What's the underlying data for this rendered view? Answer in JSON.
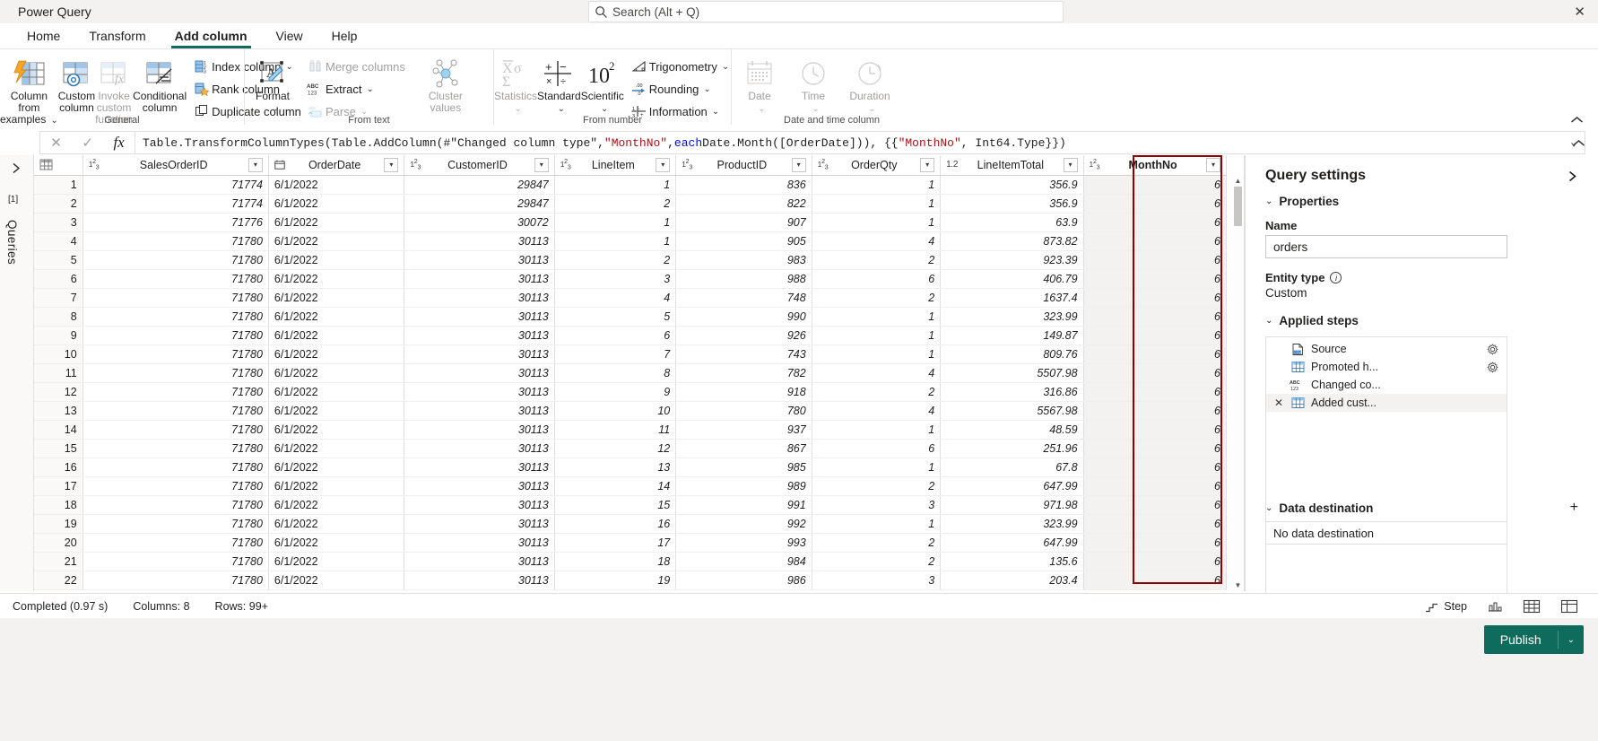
{
  "window": {
    "app_title": "Power Query",
    "close_label": "✕"
  },
  "search": {
    "placeholder": "Search (Alt + Q)",
    "icon": "search-icon"
  },
  "ribbon": {
    "tabs": [
      {
        "label": "Home",
        "active": false
      },
      {
        "label": "Transform",
        "active": false
      },
      {
        "label": "Add column",
        "active": true
      },
      {
        "label": "View",
        "active": false
      },
      {
        "label": "Help",
        "active": false
      }
    ],
    "collapse_icon": "chevron-up-icon",
    "groups": [
      {
        "label": "General",
        "big_buttons": [
          {
            "label": "Column from examples",
            "has_chevron": true,
            "disabled": false,
            "icon": "column-from-examples-icon"
          },
          {
            "label": "Custom column",
            "has_chevron": false,
            "disabled": false,
            "icon": "custom-column-icon"
          },
          {
            "label": "Invoke custom function",
            "has_chevron": false,
            "disabled": true,
            "icon": "invoke-custom-function-icon"
          },
          {
            "label": "Conditional column",
            "has_chevron": false,
            "disabled": false,
            "icon": "conditional-column-icon"
          }
        ],
        "small_buttons": [
          {
            "label": "Index column",
            "has_chevron": true,
            "disabled": false,
            "icon": "index-column-icon"
          },
          {
            "label": "Rank column",
            "has_chevron": false,
            "disabled": false,
            "icon": "rank-column-icon"
          },
          {
            "label": "Duplicate column",
            "has_chevron": false,
            "disabled": false,
            "icon": "duplicate-column-icon"
          }
        ]
      },
      {
        "label": "From text",
        "big_buttons": [
          {
            "label": "Format",
            "has_chevron": true,
            "disabled": false,
            "icon": "format-icon"
          }
        ],
        "small_buttons": [
          {
            "label": "Merge columns",
            "has_chevron": false,
            "disabled": true,
            "icon": "merge-columns-icon"
          },
          {
            "label": "Extract",
            "has_chevron": true,
            "disabled": false,
            "icon": "extract-abc123-icon"
          },
          {
            "label": "Parse",
            "has_chevron": true,
            "disabled": true,
            "icon": "parse-icon"
          }
        ],
        "extra_big": [
          {
            "label": "Cluster values",
            "has_chevron": false,
            "disabled": true,
            "icon": "cluster-values-icon"
          }
        ]
      },
      {
        "label": "From number",
        "big_buttons": [
          {
            "label": "Statistics",
            "has_chevron": true,
            "disabled": true,
            "icon": "statistics-sigma-icon"
          },
          {
            "label": "Standard",
            "has_chevron": true,
            "disabled": false,
            "icon": "standard-operators-icon"
          },
          {
            "label": "Scientific",
            "has_chevron": true,
            "disabled": false,
            "icon": "scientific-power-icon"
          }
        ],
        "small_buttons": [
          {
            "label": "Trigonometry",
            "has_chevron": true,
            "disabled": false,
            "icon": "trigonometry-icon"
          },
          {
            "label": "Rounding",
            "has_chevron": true,
            "disabled": false,
            "icon": "rounding-icon"
          },
          {
            "label": "Information",
            "has_chevron": true,
            "disabled": false,
            "icon": "information-fraction-icon"
          }
        ]
      },
      {
        "label": "Date and time column",
        "big_buttons": [
          {
            "label": "Date",
            "has_chevron": true,
            "disabled": true,
            "icon": "calendar-icon"
          },
          {
            "label": "Time",
            "has_chevron": true,
            "disabled": true,
            "icon": "clock-icon"
          },
          {
            "label": "Duration",
            "has_chevron": true,
            "disabled": true,
            "icon": "duration-icon"
          }
        ],
        "small_buttons": []
      }
    ]
  },
  "formula_bar": {
    "cancel_icon": "close-icon",
    "accept_icon": "checkmark-icon",
    "fx_icon": "fx-icon",
    "expand_icon": "chevron-down-icon",
    "tokens": [
      {
        "t": "Table.TransformColumnTypes(Table.AddColumn(#\"Changed column type\", ",
        "k": "p"
      },
      {
        "t": "\"MonthNo\"",
        "k": "s"
      },
      {
        "t": ", ",
        "k": "p"
      },
      {
        "t": "each",
        "k": "w"
      },
      {
        "t": " Date.Month([OrderDate])), {{",
        "k": "p"
      },
      {
        "t": "\"MonthNo\"",
        "k": "s"
      },
      {
        "t": ", Int64.Type}})",
        "k": "p"
      }
    ],
    "full_text": "Table.TransformColumnTypes(Table.AddColumn(#\"Changed column type\", \"MonthNo\", each Date.Month([OrderDate])), {{\"MonthNo\", Int64.Type}})"
  },
  "queries_rail": {
    "expand_icon": "chevron-right-icon",
    "label": "Queries",
    "count": "[1]"
  },
  "table_data": {
    "type": "table",
    "corner_icon": "select-all-table-icon",
    "columns": [
      {
        "name": "SalesOrderID",
        "type_icon": "123",
        "align": "num",
        "selected": false
      },
      {
        "name": "OrderDate",
        "type_icon": "cal",
        "align": "plain",
        "selected": false
      },
      {
        "name": "CustomerID",
        "type_icon": "123",
        "align": "num",
        "selected": false
      },
      {
        "name": "LineItem",
        "type_icon": "123",
        "align": "num",
        "selected": false
      },
      {
        "name": "ProductID",
        "type_icon": "123",
        "align": "num",
        "selected": false
      },
      {
        "name": "OrderQty",
        "type_icon": "123",
        "align": "num",
        "selected": false
      },
      {
        "name": "LineItemTotal",
        "type_icon": "1.2",
        "align": "num",
        "selected": false
      },
      {
        "name": "MonthNo",
        "type_icon": "123",
        "align": "num",
        "selected": true
      }
    ],
    "rows": [
      {
        "n": "1",
        "v": [
          "71774",
          "6/1/2022",
          "29847",
          "1",
          "836",
          "1",
          "356.9",
          "6"
        ]
      },
      {
        "n": "2",
        "v": [
          "71774",
          "6/1/2022",
          "29847",
          "2",
          "822",
          "1",
          "356.9",
          "6"
        ]
      },
      {
        "n": "3",
        "v": [
          "71776",
          "6/1/2022",
          "30072",
          "1",
          "907",
          "1",
          "63.9",
          "6"
        ]
      },
      {
        "n": "4",
        "v": [
          "71780",
          "6/1/2022",
          "30113",
          "1",
          "905",
          "4",
          "873.82",
          "6"
        ]
      },
      {
        "n": "5",
        "v": [
          "71780",
          "6/1/2022",
          "30113",
          "2",
          "983",
          "2",
          "923.39",
          "6"
        ]
      },
      {
        "n": "6",
        "v": [
          "71780",
          "6/1/2022",
          "30113",
          "3",
          "988",
          "6",
          "406.79",
          "6"
        ]
      },
      {
        "n": "7",
        "v": [
          "71780",
          "6/1/2022",
          "30113",
          "4",
          "748",
          "2",
          "1637.4",
          "6"
        ]
      },
      {
        "n": "8",
        "v": [
          "71780",
          "6/1/2022",
          "30113",
          "5",
          "990",
          "1",
          "323.99",
          "6"
        ]
      },
      {
        "n": "9",
        "v": [
          "71780",
          "6/1/2022",
          "30113",
          "6",
          "926",
          "1",
          "149.87",
          "6"
        ]
      },
      {
        "n": "10",
        "v": [
          "71780",
          "6/1/2022",
          "30113",
          "7",
          "743",
          "1",
          "809.76",
          "6"
        ]
      },
      {
        "n": "11",
        "v": [
          "71780",
          "6/1/2022",
          "30113",
          "8",
          "782",
          "4",
          "5507.98",
          "6"
        ]
      },
      {
        "n": "12",
        "v": [
          "71780",
          "6/1/2022",
          "30113",
          "9",
          "918",
          "2",
          "316.86",
          "6"
        ]
      },
      {
        "n": "13",
        "v": [
          "71780",
          "6/1/2022",
          "30113",
          "10",
          "780",
          "4",
          "5567.98",
          "6"
        ]
      },
      {
        "n": "14",
        "v": [
          "71780",
          "6/1/2022",
          "30113",
          "11",
          "937",
          "1",
          "48.59",
          "6"
        ]
      },
      {
        "n": "15",
        "v": [
          "71780",
          "6/1/2022",
          "30113",
          "12",
          "867",
          "6",
          "251.96",
          "6"
        ]
      },
      {
        "n": "16",
        "v": [
          "71780",
          "6/1/2022",
          "30113",
          "13",
          "985",
          "1",
          "67.8",
          "6"
        ]
      },
      {
        "n": "17",
        "v": [
          "71780",
          "6/1/2022",
          "30113",
          "14",
          "989",
          "2",
          "647.99",
          "6"
        ]
      },
      {
        "n": "18",
        "v": [
          "71780",
          "6/1/2022",
          "30113",
          "15",
          "991",
          "3",
          "971.98",
          "6"
        ]
      },
      {
        "n": "19",
        "v": [
          "71780",
          "6/1/2022",
          "30113",
          "16",
          "992",
          "1",
          "323.99",
          "6"
        ]
      },
      {
        "n": "20",
        "v": [
          "71780",
          "6/1/2022",
          "30113",
          "17",
          "993",
          "2",
          "647.99",
          "6"
        ]
      },
      {
        "n": "21",
        "v": [
          "71780",
          "6/1/2022",
          "30113",
          "18",
          "984",
          "2",
          "135.6",
          "6"
        ]
      },
      {
        "n": "22",
        "v": [
          "71780",
          "6/1/2022",
          "30113",
          "19",
          "986",
          "3",
          "203.4",
          "6"
        ]
      }
    ],
    "selection_highlight_color": "#8b0000"
  },
  "query_settings": {
    "title": "Query settings",
    "close_icon": "chevron-right-icon",
    "properties": {
      "section_label": "Properties",
      "name_label": "Name",
      "name_value": "orders",
      "entity_type_label": "Entity type",
      "entity_type_info_icon": "info-icon",
      "entity_type_value": "Custom"
    },
    "applied_steps": {
      "section_label": "Applied steps",
      "steps": [
        {
          "label": "Source",
          "icon": "csv-file-icon",
          "gear": true,
          "delete": false,
          "selected": false
        },
        {
          "label": "Promoted h...",
          "icon": "table-grid-icon",
          "gear": true,
          "delete": false,
          "selected": false
        },
        {
          "label": "Changed co...",
          "icon": "abc123-icon",
          "gear": false,
          "delete": false,
          "selected": false
        },
        {
          "label": "Added cust...",
          "icon": "table-grid-icon",
          "gear": false,
          "delete": true,
          "selected": true
        }
      ]
    },
    "data_destination": {
      "section_label": "Data destination",
      "add_icon": "plus-icon",
      "value": "No data destination"
    },
    "panel_collapse_icon": "chevron-up-icon"
  },
  "status_bar": {
    "completed": "Completed (0.97 s)",
    "columns": "Columns: 8",
    "rows": "Rows: 99+",
    "step_label": "Step",
    "step_icon": "step-icon",
    "profile_icon": "column-profile-icon",
    "grid_view_icon": "grid-view-icon",
    "schema_view_icon": "schema-view-icon"
  },
  "footer": {
    "publish_label": "Publish",
    "publish_chevron": "⌄",
    "publish_color": "#0f6b5c"
  }
}
